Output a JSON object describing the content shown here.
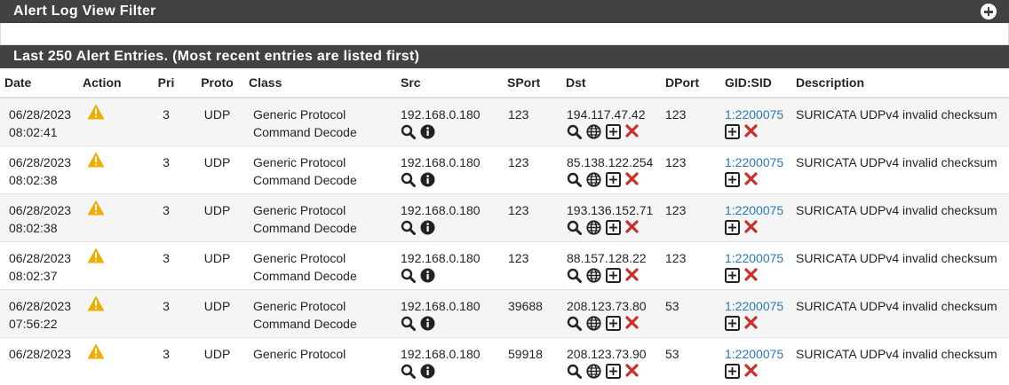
{
  "filter_panel": {
    "title": "Alert Log View Filter",
    "icon": "plus-circle-icon"
  },
  "alerts_panel": {
    "title": "Last 250 Alert Entries. (Most recent entries are listed first)"
  },
  "columns": [
    "Date",
    "Action",
    "Pri",
    "Proto",
    "Class",
    "Src",
    "SPort",
    "Dst",
    "DPort",
    "GID:SID",
    "Description"
  ],
  "rows": [
    {
      "date": "06/28/2023",
      "time": "08:02:41",
      "pri": "3",
      "proto": "UDP",
      "class1": "Generic Protocol",
      "class2": "Command Decode",
      "src": "192.168.0.180",
      "sport": "123",
      "dst": "194.117.47.42",
      "dport": "123",
      "gidsid": "1:2200075",
      "desc": "SURICATA UDPv4 invalid checksum"
    },
    {
      "date": "06/28/2023",
      "time": "08:02:38",
      "pri": "3",
      "proto": "UDP",
      "class1": "Generic Protocol",
      "class2": "Command Decode",
      "src": "192.168.0.180",
      "sport": "123",
      "dst": "85.138.122.254",
      "dport": "123",
      "gidsid": "1:2200075",
      "desc": "SURICATA UDPv4 invalid checksum"
    },
    {
      "date": "06/28/2023",
      "time": "08:02:38",
      "pri": "3",
      "proto": "UDP",
      "class1": "Generic Protocol",
      "class2": "Command Decode",
      "src": "192.168.0.180",
      "sport": "123",
      "dst": "193.136.152.71",
      "dport": "123",
      "gidsid": "1:2200075",
      "desc": "SURICATA UDPv4 invalid checksum"
    },
    {
      "date": "06/28/2023",
      "time": "08:02:37",
      "pri": "3",
      "proto": "UDP",
      "class1": "Generic Protocol",
      "class2": "Command Decode",
      "src": "192.168.0.180",
      "sport": "123",
      "dst": "88.157.128.22",
      "dport": "123",
      "gidsid": "1:2200075",
      "desc": "SURICATA UDPv4 invalid checksum"
    },
    {
      "date": "06/28/2023",
      "time": "07:56:22",
      "pri": "3",
      "proto": "UDP",
      "class1": "Generic Protocol",
      "class2": "Command Decode",
      "src": "192.168.0.180",
      "sport": "39688",
      "dst": "208.123.73.80",
      "dport": "53",
      "gidsid": "1:2200075",
      "desc": "SURICATA UDPv4 invalid checksum"
    },
    {
      "date": "06/28/2023",
      "time": "",
      "pri": "3",
      "proto": "UDP",
      "class1": "Generic Protocol",
      "class2": "",
      "src": "192.168.0.180",
      "sport": "59918",
      "dst": "208.123.73.90",
      "dport": "53",
      "gidsid": "1:2200075",
      "desc": "SURICATA UDPv4 invalid checksum"
    }
  ],
  "colors": {
    "header_bg": "#424242",
    "link": "#2a7ab8",
    "warning": "#f0ad00",
    "remove": "#c9302c"
  },
  "icons": {
    "action": "warning-icon",
    "src": [
      "search-icon",
      "info-icon"
    ],
    "dst": [
      "search-icon",
      "globe-icon",
      "plus-square-icon",
      "remove-icon"
    ],
    "sid": [
      "plus-square-icon",
      "remove-icon"
    ]
  }
}
